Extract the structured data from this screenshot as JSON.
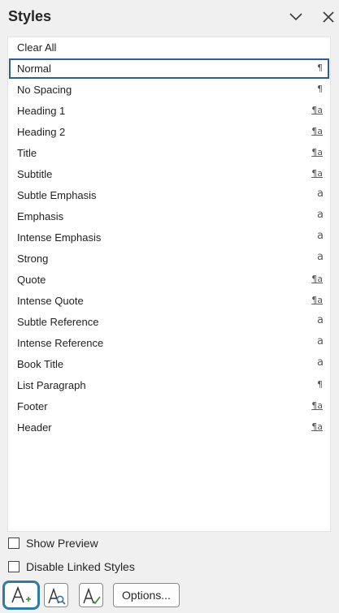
{
  "header": {
    "title": "Styles",
    "collapse_icon": "chevron-down-icon",
    "close_icon": "close-icon"
  },
  "styles": [
    {
      "label": "Clear All",
      "type": "none",
      "selected": false
    },
    {
      "label": "Normal",
      "type": "paragraph",
      "selected": true
    },
    {
      "label": "No Spacing",
      "type": "paragraph",
      "selected": false
    },
    {
      "label": "Heading 1",
      "type": "linked",
      "selected": false
    },
    {
      "label": "Heading 2",
      "type": "linked",
      "selected": false
    },
    {
      "label": "Title",
      "type": "linked",
      "selected": false
    },
    {
      "label": "Subtitle",
      "type": "linked",
      "selected": false
    },
    {
      "label": "Subtle Emphasis",
      "type": "character",
      "selected": false
    },
    {
      "label": "Emphasis",
      "type": "character",
      "selected": false
    },
    {
      "label": "Intense Emphasis",
      "type": "character",
      "selected": false
    },
    {
      "label": "Strong",
      "type": "character",
      "selected": false
    },
    {
      "label": "Quote",
      "type": "linked",
      "selected": false
    },
    {
      "label": "Intense Quote",
      "type": "linked",
      "selected": false
    },
    {
      "label": "Subtle Reference",
      "type": "character",
      "selected": false
    },
    {
      "label": "Intense Reference",
      "type": "character",
      "selected": false
    },
    {
      "label": "Book Title",
      "type": "character",
      "selected": false
    },
    {
      "label": "List Paragraph",
      "type": "paragraph",
      "selected": false
    },
    {
      "label": "Footer",
      "type": "linked",
      "selected": false
    },
    {
      "label": "Header",
      "type": "linked",
      "selected": false
    }
  ],
  "type_glyphs": {
    "paragraph": "¶",
    "linked": "¶a",
    "character": "a",
    "none": ""
  },
  "options": {
    "show_preview": {
      "label": "Show Preview",
      "checked": false
    },
    "disable_linked": {
      "label": "Disable Linked Styles",
      "checked": false
    }
  },
  "bottom": {
    "new_style_icon": "new-style-icon",
    "style_inspector_icon": "style-inspector-icon",
    "manage_styles_icon": "manage-styles-icon",
    "options_label": "Options..."
  },
  "colors": {
    "selection_border": "#2e5f8f",
    "focus_ring": "#2e7ba6",
    "panel_bg": "#f0f0f0",
    "list_bg": "#ffffff",
    "accent_green": "#3a8f3a",
    "accent_blue": "#2f6fb0"
  }
}
